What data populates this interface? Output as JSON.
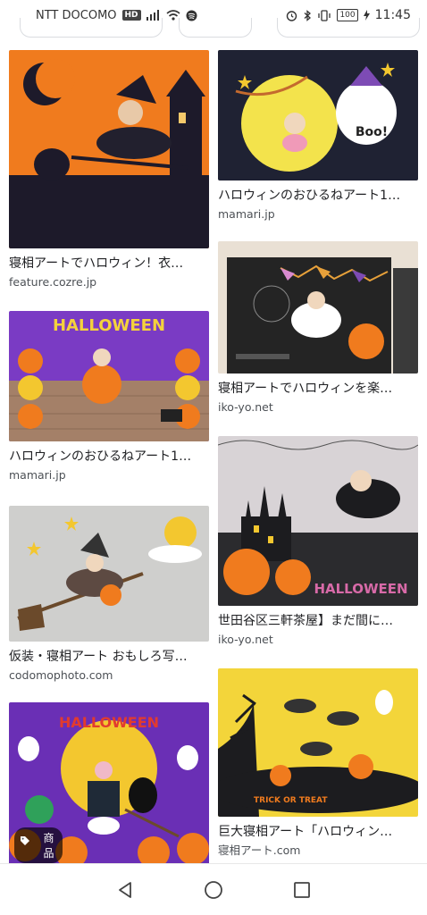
{
  "status_bar": {
    "carrier": "NTT DOCOMO",
    "hd": "HD",
    "battery": "100",
    "time": "11:45"
  },
  "results": {
    "left": [
      {
        "caption": "寝相アートでハロウィン！衣…",
        "source": "feature.cozre.jp"
      },
      {
        "caption": "ハロウィンのおひるねアート1…",
        "source": "mamari.jp"
      },
      {
        "caption": "仮装・寝相アート おもしろ写…",
        "source": "codomophoto.com"
      },
      {
        "caption": "",
        "source": "",
        "badge": "商品"
      }
    ],
    "right": [
      {
        "caption": "ハロウィンのおひるねアート1…",
        "source": "mamari.jp"
      },
      {
        "caption": "寝相アートでハロウィンを楽…",
        "source": "iko-yo.net"
      },
      {
        "caption": "世田谷区三軒茶屋】まだ間に…",
        "source": "iko-yo.net"
      },
      {
        "caption": "巨大寝相アート「ハロウィン…",
        "source": "寝相アート.com"
      }
    ]
  },
  "image_text": {
    "halloween_banner_1": "HALLOWEEN",
    "halloween_banner_2": "HALLOWEEN",
    "boo": "Boo!",
    "halloween_banner_3": "HALLOWEEN",
    "trick_or_treat": "TRICK OR TREAT"
  },
  "colors": {
    "accent_orange": "#f07b1e",
    "night_dark": "#1d1a2a",
    "purple": "#6a2fb5"
  }
}
